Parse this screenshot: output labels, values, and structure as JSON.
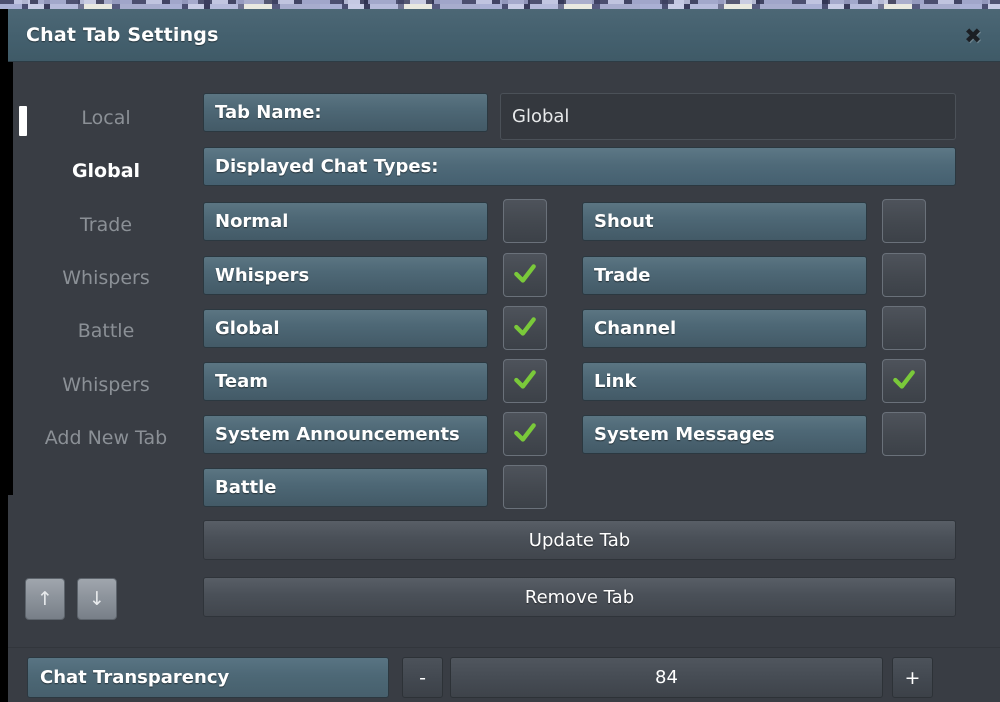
{
  "window": {
    "title": "Chat Tab Settings",
    "close_icon": "close-icon",
    "close_glyph": "✖"
  },
  "sidebar": {
    "items": [
      {
        "label": "Local",
        "active": false
      },
      {
        "label": "Global",
        "active": true
      },
      {
        "label": "Trade",
        "active": false
      },
      {
        "label": "Whispers",
        "active": false
      },
      {
        "label": "Battle",
        "active": false
      },
      {
        "label": "Whispers",
        "active": false
      },
      {
        "label": "Add New Tab",
        "active": false
      }
    ],
    "move_up_label": "↑",
    "move_down_label": "↓",
    "move_up_icon": "arrow-up-icon",
    "move_down_icon": "arrow-down-icon"
  },
  "form": {
    "tab_name_label": "Tab Name:",
    "tab_name_value": "Global",
    "tab_name_placeholder": "Global",
    "displayed_chat_types_label": "Displayed Chat Types:"
  },
  "chat_types": {
    "left": [
      {
        "label": "Normal",
        "checked": false
      },
      {
        "label": "Whispers",
        "checked": true
      },
      {
        "label": "Global",
        "checked": true
      },
      {
        "label": "Team",
        "checked": true
      },
      {
        "label": "System Announcements",
        "checked": true
      },
      {
        "label": "Battle",
        "checked": false
      }
    ],
    "right": [
      {
        "label": "Shout",
        "checked": false
      },
      {
        "label": "Trade",
        "checked": false
      },
      {
        "label": "Channel",
        "checked": false
      },
      {
        "label": "Link",
        "checked": true
      },
      {
        "label": "System Messages",
        "checked": false
      }
    ]
  },
  "actions": {
    "update_tab": "Update Tab",
    "remove_tab": "Remove Tab"
  },
  "transparency": {
    "label": "Chat Transparency",
    "decrement": "-",
    "increment": "+",
    "value": "84"
  },
  "colors": {
    "panel_bg": "#393d44",
    "titlebar": "#44606e",
    "chip_blue": "#4e6876",
    "check_green": "#7ac93a",
    "text_white": "#ffffff",
    "text_muted": "#8b9096"
  }
}
